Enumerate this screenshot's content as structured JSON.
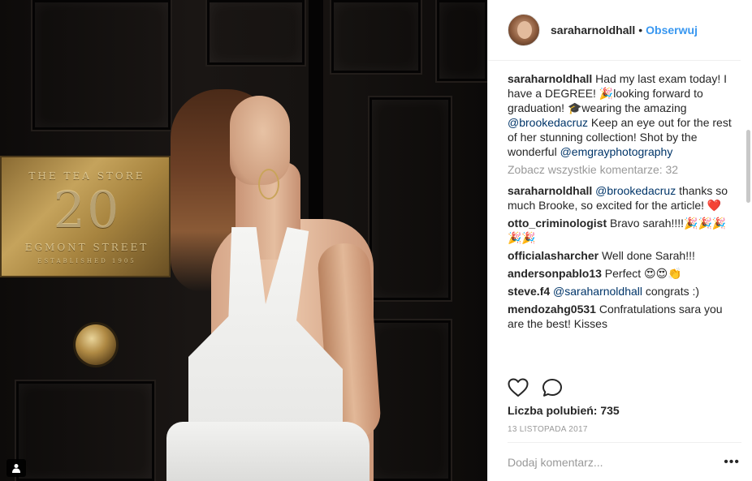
{
  "photo": {
    "plaque_line1": "THE TEA STORE",
    "plaque_number": "20",
    "plaque_line2": "EGMONT STREET",
    "plaque_line3": "ESTABLISHED 1905",
    "tag_icon": "person-tag-icon"
  },
  "header": {
    "username": "saraharnoldhall",
    "separator": "•",
    "follow_label": "Obserwuj"
  },
  "caption": {
    "user": "saraharnoldhall",
    "text_1": " Had my last exam today! I have a DEGREE! 🎉looking forward to graduation! 🎓wearing the amazing ",
    "mention_1": "@brookedacruz",
    "text_2": " Keep an eye out for the rest of her stunning collection! Shot by the wonderful ",
    "mention_2": "@emgrayphotography"
  },
  "view_all_comments": "Zobacz wszystkie komentarze: 32",
  "comments": [
    {
      "user": "saraharnoldhall",
      "mention": "@brookedacruz",
      "text": " thanks so much Brooke, so excited for the article! ❤️"
    },
    {
      "user": "otto_criminologist",
      "mention": "",
      "text": " Bravo sarah!!!!🎉🎉🎉🎉🎉"
    },
    {
      "user": "officialasharcher",
      "mention": "",
      "text": " Well done Sarah!!!"
    },
    {
      "user": "andersonpablo13",
      "mention": "",
      "text": " Perfect 😍😍👏"
    },
    {
      "user": "steve.f4",
      "mention": "@saraharnoldhall",
      "text": " congrats :)"
    },
    {
      "user": "mendozahg0531",
      "mention": "",
      "text": " Confratulations sara you are the best! Kisses"
    }
  ],
  "actions": {
    "like_icon": "heart-icon",
    "comment_icon": "comment-bubble-icon"
  },
  "likes_text": "Liczba polubień: 735",
  "date_text": "13 LISTOPADA 2017",
  "add_comment": {
    "placeholder": "Dodaj komentarz...",
    "more_label": "•••"
  },
  "colors": {
    "link_blue": "#3897f0",
    "mention_blue": "#003569",
    "muted_gray": "#999999",
    "text_dark": "#262626"
  }
}
